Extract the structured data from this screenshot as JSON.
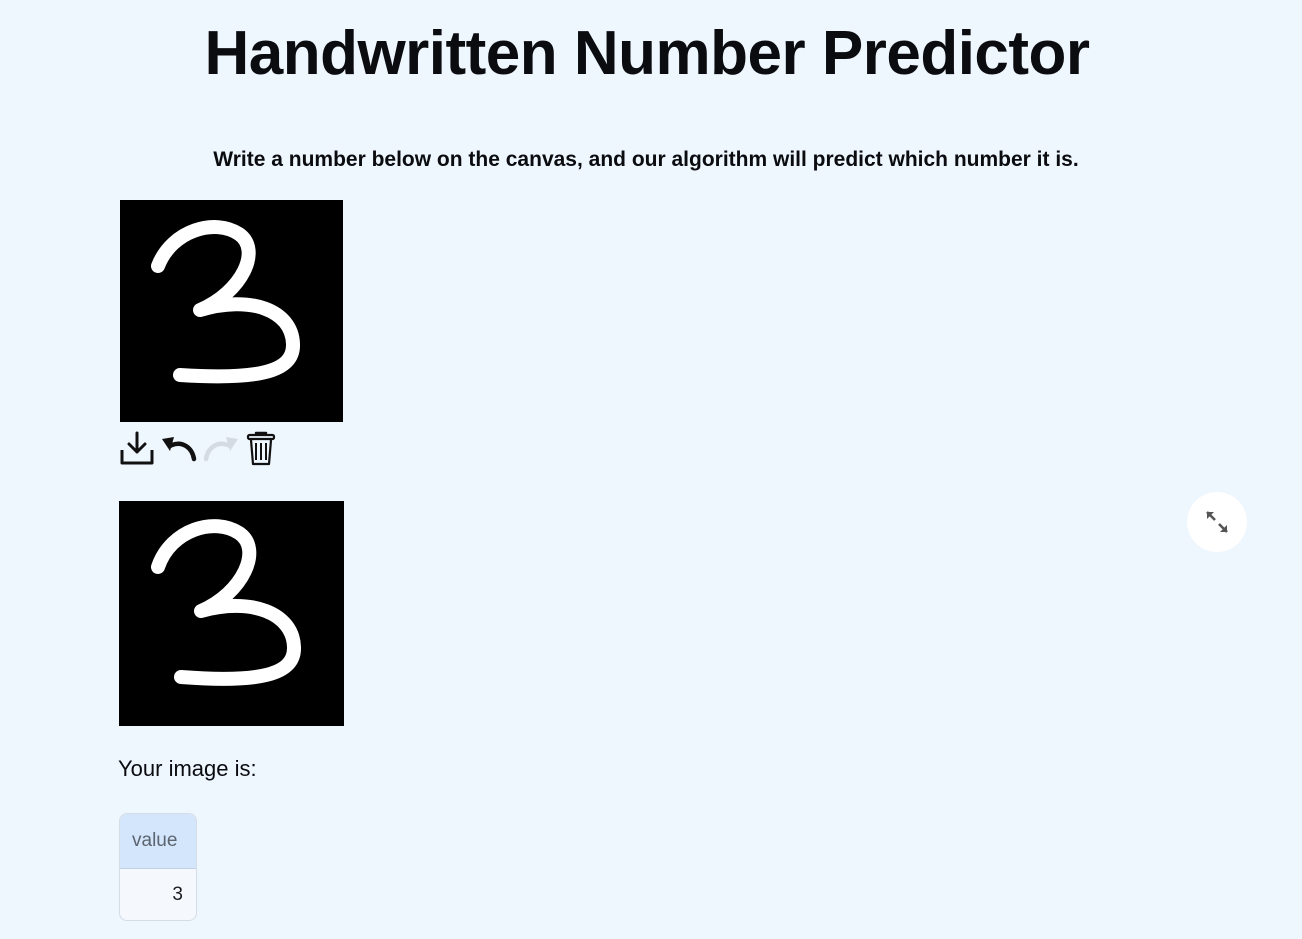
{
  "header": {
    "title": "Handwritten Number Predictor",
    "subtitle": "Write a number below on the canvas, and our algorithm will predict which number it is."
  },
  "canvas": {
    "background": "#000000",
    "stroke_color": "#ffffff",
    "drawn_digit": "3"
  },
  "toolbar": {
    "download_icon": "download-icon",
    "undo_icon": "undo-icon",
    "redo_icon": "redo-icon",
    "delete_icon": "trash-icon"
  },
  "preview": {
    "background": "#000000"
  },
  "fullscreen": {
    "icon": "expand-icon"
  },
  "result": {
    "label": "Your image is:",
    "table": {
      "columns": [
        "value"
      ],
      "rows": [
        [
          "3"
        ]
      ]
    }
  },
  "colors": {
    "page_background": "#eef6fe",
    "table_header": "#d4e6fb",
    "redo_disabled": "#d5dbe3"
  }
}
